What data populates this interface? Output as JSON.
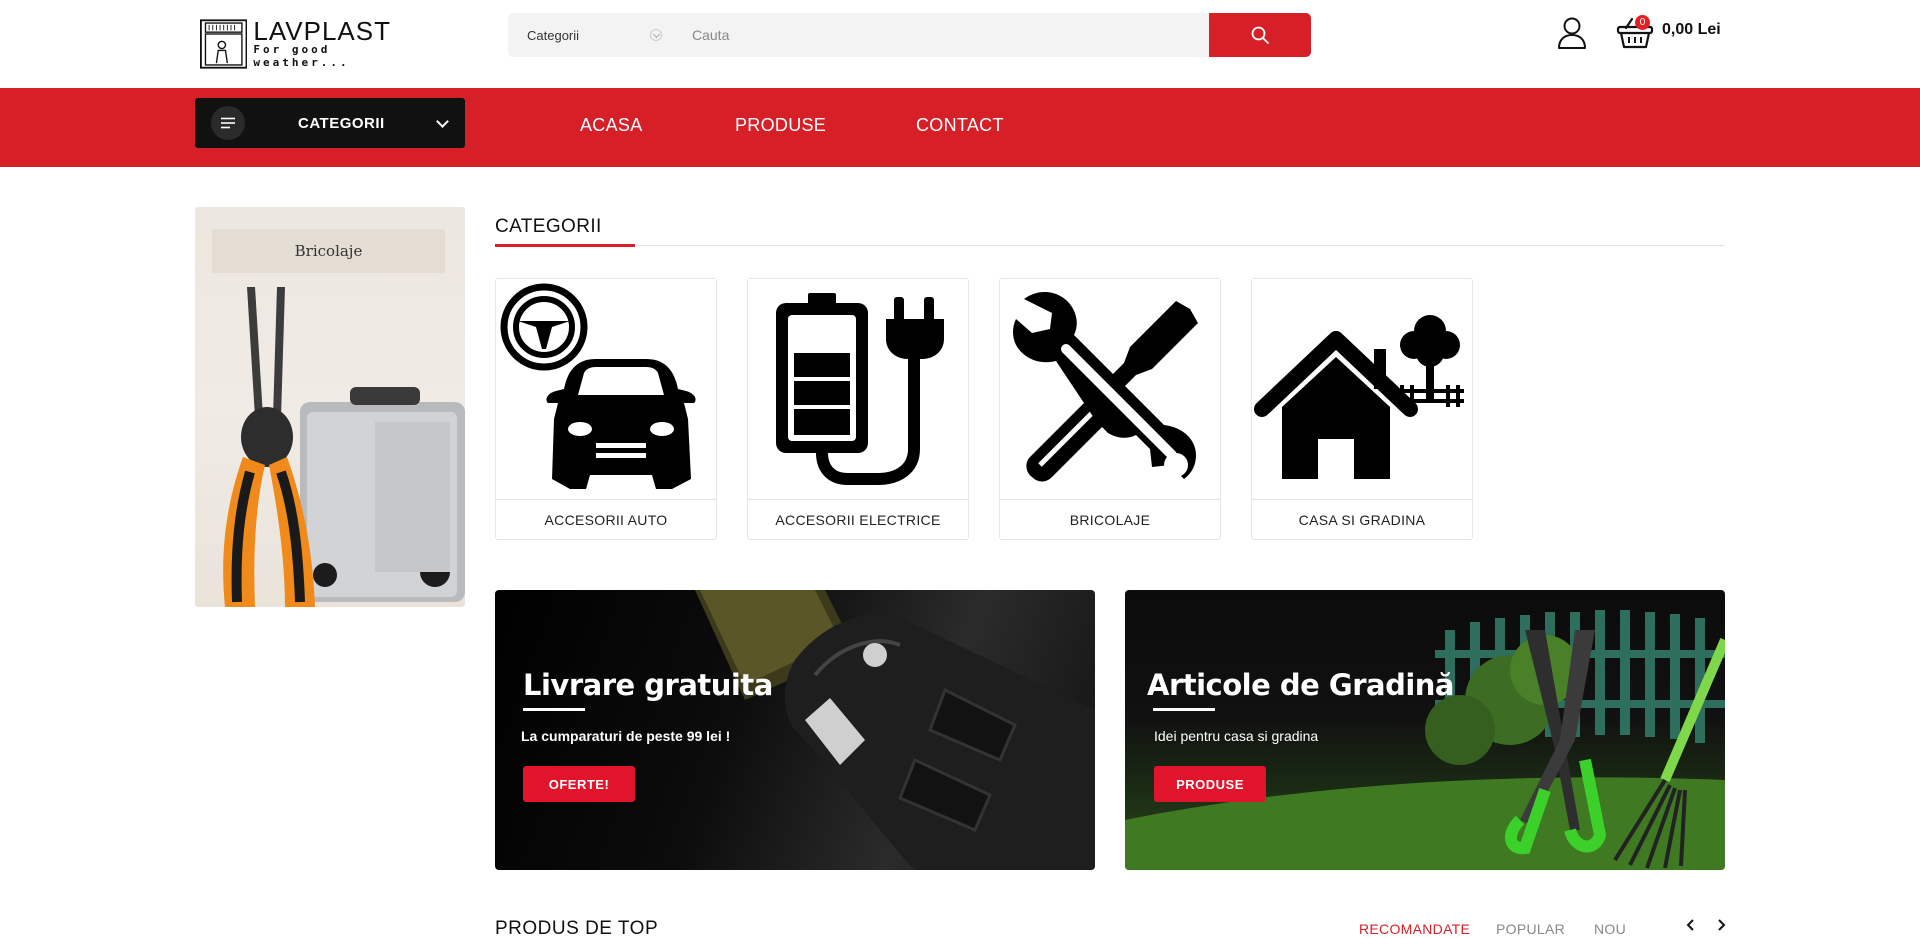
{
  "header": {
    "logo_name": "LAVPLAST",
    "logo_tagline": "For good weather...",
    "search": {
      "category_label": "Categorii",
      "placeholder": "Cauta"
    },
    "cart": {
      "count": "0",
      "total": "0,00 Lei"
    }
  },
  "nav": {
    "categories_button": "CATEGORII",
    "links": [
      "ACASA",
      "PRODUSE",
      "CONTACT"
    ]
  },
  "sidebar_banner": {
    "label": "Bricolaje"
  },
  "categories": {
    "title": "CATEGORII",
    "items": [
      {
        "name": "ACCESORII AUTO",
        "icon": "car-icon"
      },
      {
        "name": "ACCESORII ELECTRICE",
        "icon": "battery-plug-icon"
      },
      {
        "name": "BRICOLAJE",
        "icon": "tools-icon"
      },
      {
        "name": "CASA SI GRADINA",
        "icon": "house-tree-icon"
      }
    ]
  },
  "promos": [
    {
      "title": "Livrare gratuita",
      "subtitle": "La cumparaturi de peste 99 lei !",
      "button": "OFERTE!"
    },
    {
      "title": "Articole de Gradină",
      "subtitle": "Idei pentru casa si gradina",
      "button": "PRODUSE"
    }
  ],
  "top_products": {
    "title": "PRODUS DE TOP",
    "tabs": [
      "RECOMANDATE",
      "POPULAR",
      "NOU"
    ],
    "active_tab": "RECOMANDATE"
  },
  "colors": {
    "brand_red": "#d71f28",
    "dark": "#111111"
  }
}
